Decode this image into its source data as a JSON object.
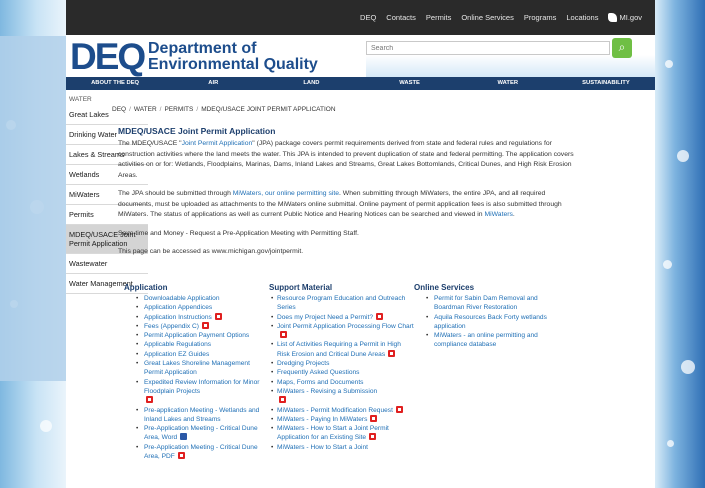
{
  "topbar": {
    "links": [
      "DEQ",
      "Contacts",
      "Permits",
      "Online Services",
      "Programs",
      "Locations"
    ],
    "mi_label": "MI.gov"
  },
  "header": {
    "logo": "DEQ",
    "line1": "Department of",
    "line2": "Environmental Quality",
    "search_placeholder": "Search"
  },
  "mainnav": [
    "ABOUT THE DEQ",
    "AIR",
    "LAND",
    "WASTE",
    "WATER",
    "SUSTAINABILITY"
  ],
  "leftnav": {
    "section": "WATER",
    "items": [
      "Great Lakes",
      "Drinking Water",
      "Lakes & Streams",
      "Wetlands",
      "MiWaters",
      "Permits",
      "MDEQ/USACE Joint Permit Application",
      "Wastewater",
      "Water Management"
    ]
  },
  "breadcrumb": [
    "DEQ",
    "WATER",
    "PERMITS",
    "MDEQ/USACE JOINT PERMIT APPLICATION"
  ],
  "content": {
    "title": "MDEQ/USACE Joint Permit Application",
    "p1_a": "The MDEQ/USACE \"",
    "p1_link": "Joint Permit Application",
    "p1_b": "\" (JPA) package covers permit requirements derived from state and federal rules and regulations for construction activities where the land meets the water. This JPA is intended to prevent duplication of state and federal permitting. The application covers activities on or for: Wetlands, Floodplains, Marinas, Dams, Inland Lakes and Streams, Great Lakes Bottomlands, Critical Dunes, and High Risk Erosion Areas.",
    "p2_a": "The JPA should be submitted through ",
    "p2_link": "MiWaters, our online permitting site",
    "p2_b": ". When submitting through MiWaters, the entire JPA, and all required documents, must be uploaded as attachments to the MiWaters online submittal. Online payment of permit application fees is also submitted through MiWaters.  The status of applications as well as current Public Notice and Hearing Notices can be searched and viewed in ",
    "p2_link2": "MiWaters",
    "p2_c": ".",
    "p3": "Save time and Money - Request a Pre-Application Meeting with Permitting Staff.",
    "p4": "This page can be accessed as www.michigan.gov/jointpermit."
  },
  "columns": {
    "application": {
      "heading": "Application",
      "items": [
        {
          "text": "Downloadable Application",
          "icon": ""
        },
        {
          "text": "Application Appendices",
          "icon": ""
        },
        {
          "text": "Application Instructions",
          "icon": "pdf"
        },
        {
          "text": "Fees (Appendix C)",
          "icon": "pdf"
        },
        {
          "text": "Permit Application Payment Options",
          "icon": ""
        },
        {
          "text": "Applicable Regulations",
          "icon": ""
        },
        {
          "text": "Application EZ Guides",
          "icon": ""
        },
        {
          "text": "Great Lakes Shoreline Management Permit Application",
          "icon": ""
        },
        {
          "text": "Expedited Review Information for Minor Floodplain Projects",
          "icon": "pdf-below"
        },
        {
          "text": "Pre-application Meeting - Wetlands and Inland Lakes and Streams",
          "icon": ""
        },
        {
          "text": "Pre-Application Meeting - Critical Dune Area, Word",
          "icon": "doc"
        },
        {
          "text": "Pre-Application Meeting - Critical Dune Area, PDF",
          "icon": "pdf"
        }
      ]
    },
    "support": {
      "heading": "Support Material",
      "items": [
        {
          "text": "Resource Program Education and Outreach Series",
          "icon": ""
        },
        {
          "text": "Does my Project Need a Permit?",
          "icon": "pdf"
        },
        {
          "text": "Joint Permit Application Processing Flow Chart",
          "icon": "pdf"
        },
        {
          "text": "List of Activities Requiring a Permit in High Risk Erosion and Critical Dune Areas",
          "icon": "pdf"
        },
        {
          "text": "Dredging Projects",
          "icon": ""
        },
        {
          "text": "Frequently Asked Questions",
          "icon": ""
        },
        {
          "text": "Maps, Forms and Documents",
          "icon": ""
        },
        {
          "text": "MiWaters - Revising a Submission",
          "icon": "pdf-below"
        },
        {
          "text": "MiWaters - Permit Modification Request",
          "icon": "pdf"
        },
        {
          "text": "MiWaters - Paying In MiWaters",
          "icon": "pdf"
        },
        {
          "text": "MiWaters - How to Start a Joint Permit Application for an Existing Site",
          "icon": "pdf"
        },
        {
          "text": "MiWaters - How to Start a Joint",
          "icon": ""
        }
      ]
    },
    "online": {
      "heading": "Online Services",
      "items": [
        {
          "text": "Permit for Sabin Dam Removal and Boardman River Restoration",
          "icon": ""
        },
        {
          "text": "Aquila Resources Back Forty wetlands application",
          "icon": ""
        },
        {
          "text": "MiWaters - an online permitting and compliance database",
          "icon": ""
        }
      ]
    }
  },
  "colors": {
    "topbar": "#2a2a2a",
    "nav": "#1c3f6d",
    "brand": "#1d4d8c",
    "link": "#1f6fb5",
    "search_button": "#6fbf44"
  }
}
